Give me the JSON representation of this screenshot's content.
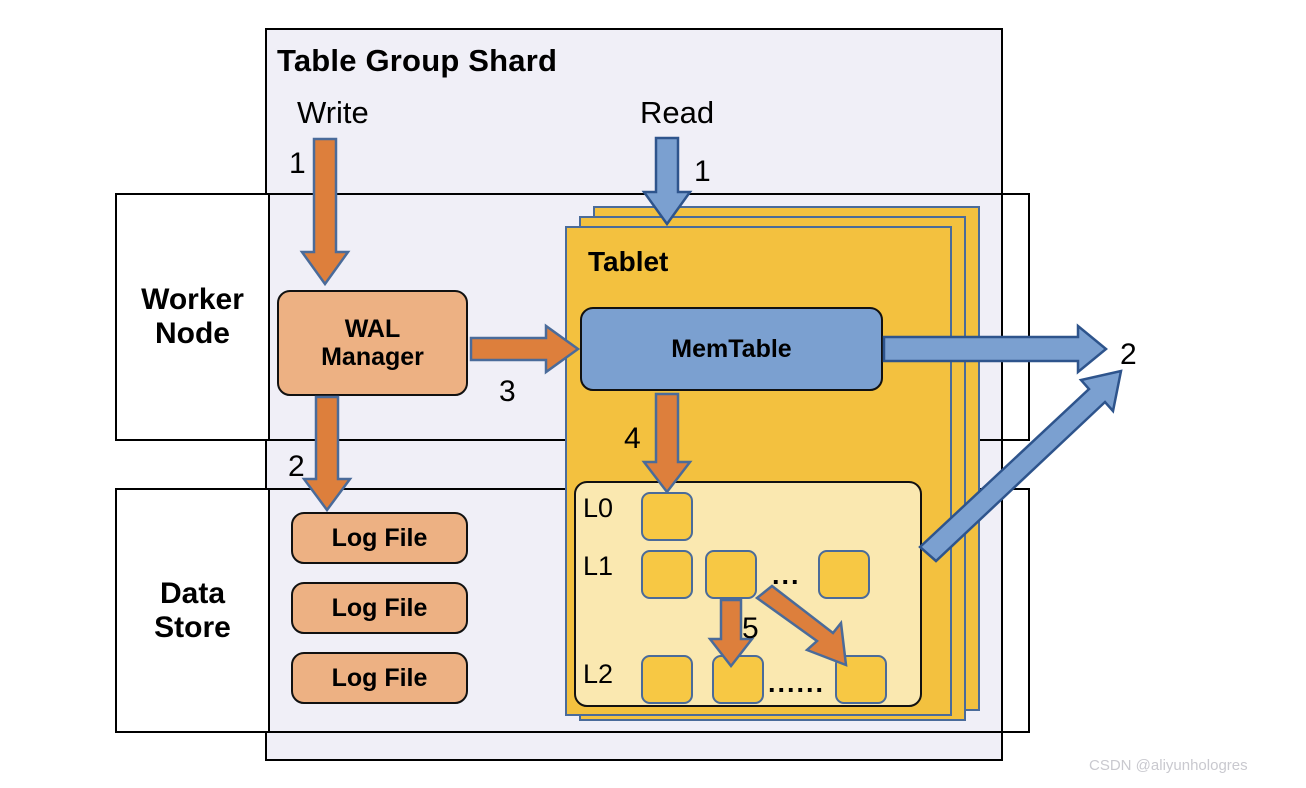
{
  "diagram": {
    "title": "Table Group Shard",
    "outer_box_label": "Table Group Shard"
  },
  "rows": {
    "worker": "Worker\nNode",
    "worker_line1": "Worker",
    "worker_line2": "Node",
    "datastore_line1": "Data",
    "datastore_line2": "Store"
  },
  "flows": {
    "write_label": "Write",
    "read_label": "Read",
    "write_step": "1",
    "read_step": "1",
    "wal_to_log_step": "2",
    "wal_to_memtable_step": "3",
    "memtable_flush_step": "4",
    "compaction_step": "5",
    "read_return_step_top": "2",
    "read_return_step_bottom": "2"
  },
  "nodes": {
    "wal_line1": "WAL",
    "wal_line2": "Manager",
    "memtable": "MemTable",
    "tablet": "Tablet",
    "log_files": [
      "Log File",
      "Log File",
      "Log File"
    ]
  },
  "lsm": {
    "levels": [
      {
        "label": "L0",
        "sst_count": 1,
        "trailing_dots": ""
      },
      {
        "label": "L1",
        "sst_count": 3,
        "trailing_dots": "..."
      },
      {
        "label": "L2",
        "sst_count": 3,
        "trailing_dots": "......"
      }
    ],
    "l1_dots": "...",
    "l2_dots": "......"
  },
  "colors": {
    "shard_background": "#F0EFF7",
    "wal_peach": "#EDB183",
    "tablet_gold": "#F3C13F",
    "memtable_blue": "#7BA0D0",
    "lsm_pale_yellow": "#FAE8B0",
    "sst_gold": "#F7C844",
    "orange_arrow": "#DD7F3C",
    "blue_arrow": "#7BA0D0",
    "arrow_outline": "#4A6B9A",
    "border_black": "#000000"
  },
  "watermark": "CSDN @aliyunhologres"
}
